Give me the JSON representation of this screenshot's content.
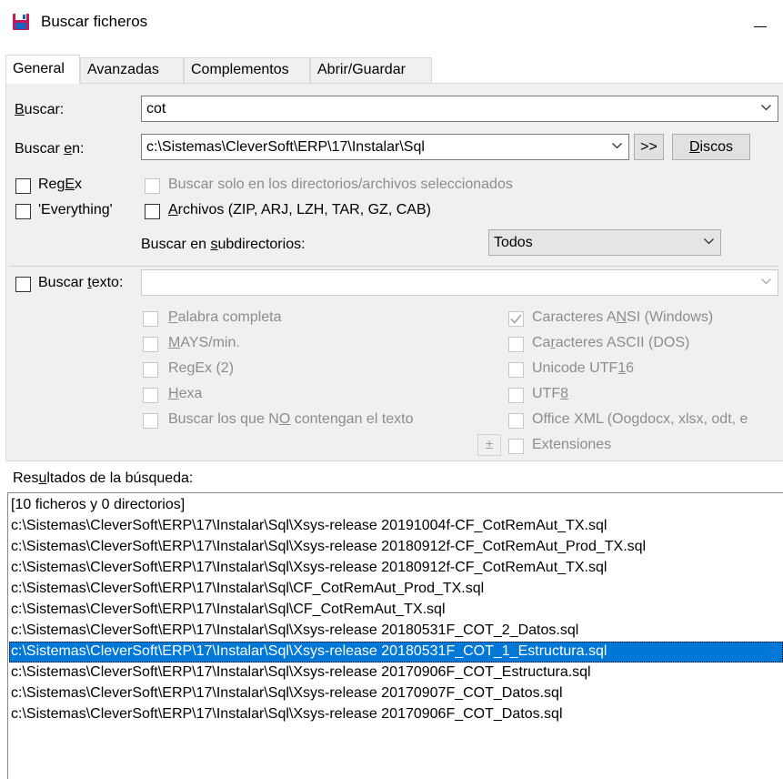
{
  "window": {
    "title": "Buscar ficheros"
  },
  "tabs": [
    "General",
    "Avanzadas",
    "Complementos",
    "Abrir/Guardar"
  ],
  "search": {
    "label": "Buscar:",
    "value": "cot",
    "in_label": "Buscar en:",
    "in_value": "c:\\Sistemas\\CleverSoft\\ERP\\17\\Instalar\\Sql",
    "browse_label": ">>",
    "drives_label": "Discos"
  },
  "options": {
    "regex": "RegEx",
    "everything": "'Everything'",
    "only_selected": "Buscar solo en los directorios/archivos seleccionados",
    "archives": "Archivos (ZIP, ARJ, LZH, TAR, GZ, CAB)",
    "subdirs_label": "Buscar en subdirectorios:",
    "subdirs_value": "Todos"
  },
  "text_search": {
    "label": "Buscar texto:",
    "value": "",
    "whole_word": "Palabra completa",
    "case": "MAYS/min.",
    "regex2": "RegEx (2)",
    "hex": "Hexa",
    "not_containing": "Buscar los que NO contengan el texto",
    "ansi": "Caracteres ANSI (Windows)",
    "ascii": "Caracteres ASCII (DOS)",
    "utf16": "Unicode UTF16",
    "utf8": "UTF8",
    "office": "Office XML (Oogdocx, xlsx, odt, e",
    "extensions": "Extensiones",
    "plusminus": "±"
  },
  "results": {
    "label": "Resultados de la búsqueda:",
    "summary": "[10 ficheros y 0 directorios]",
    "items": [
      "c:\\Sistemas\\CleverSoft\\ERP\\17\\Instalar\\Sql\\Xsys-release 20191004f-CF_CotRemAut_TX.sql",
      "c:\\Sistemas\\CleverSoft\\ERP\\17\\Instalar\\Sql\\Xsys-release 20180912f-CF_CotRemAut_Prod_TX.sql",
      "c:\\Sistemas\\CleverSoft\\ERP\\17\\Instalar\\Sql\\Xsys-release 20180912f-CF_CotRemAut_TX.sql",
      "c:\\Sistemas\\CleverSoft\\ERP\\17\\Instalar\\Sql\\CF_CotRemAut_Prod_TX.sql",
      "c:\\Sistemas\\CleverSoft\\ERP\\17\\Instalar\\Sql\\CF_CotRemAut_TX.sql",
      "c:\\Sistemas\\CleverSoft\\ERP\\17\\Instalar\\Sql\\Xsys-release 20180531F_COT_2_Datos.sql",
      "c:\\Sistemas\\CleverSoft\\ERP\\17\\Instalar\\Sql\\Xsys-release 20180531F_COT_1_Estructura.sql",
      "c:\\Sistemas\\CleverSoft\\ERP\\17\\Instalar\\Sql\\Xsys-release 20170906F_COT_Estructura.sql",
      "c:\\Sistemas\\CleverSoft\\ERP\\17\\Instalar\\Sql\\Xsys-release 20170907F_COT_Datos.sql",
      "c:\\Sistemas\\CleverSoft\\ERP\\17\\Instalar\\Sql\\Xsys-release 20170906F_COT_Datos.sql"
    ],
    "selected_index": 6
  },
  "colors": {
    "selection": "#0078d7",
    "panel": "#f0f0f0"
  },
  "icons": {
    "app": "floppy-disk-icon",
    "minimize": "minimize-icon",
    "dropdown": "chevron-down-icon",
    "checked": "check-icon"
  }
}
